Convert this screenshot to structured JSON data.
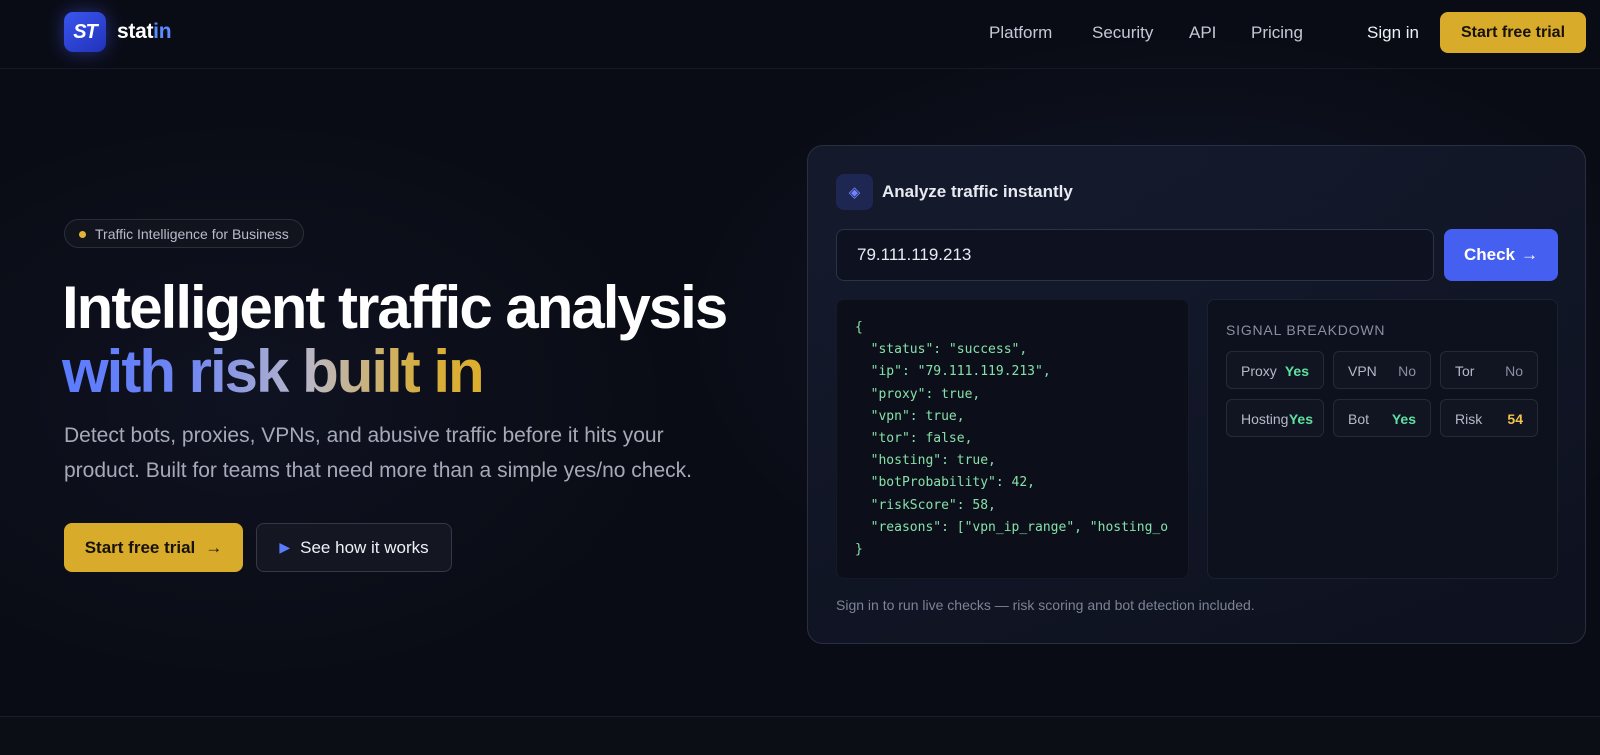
{
  "brand": {
    "logo_mark": "ST",
    "name_prefix": "stat",
    "name_suffix": "in"
  },
  "nav": {
    "links": [
      "Platform",
      "Security",
      "API",
      "Pricing"
    ],
    "sign_in": "Sign in",
    "cta": "Start free trial"
  },
  "hero": {
    "badge": "Traffic Intelligence for Business",
    "title_line1": "Intelligent traffic analysis",
    "title_line2": "with risk built in",
    "subtitle": "Detect bots, proxies, VPNs, and abusive traffic before it hits your product. Built for teams that need more than a simple yes/no check.",
    "primary_button": "Start free trial",
    "secondary_button": "See how it works"
  },
  "panel": {
    "title": "Analyze traffic instantly",
    "ip_value": "79.111.119.213",
    "check_button": "Check",
    "code_lines": [
      "{",
      "  \"status\": \"success\",",
      "  \"ip\": \"79.111.119.213\",",
      "  \"proxy\": true,",
      "  \"vpn\": true,",
      "  \"tor\": false,",
      "  \"hosting\": true,",
      "  \"botProbability\": 42,",
      "  \"riskScore\": 58,",
      "  \"reasons\": [\"vpn_ip_range\", \"hosting_o",
      "}"
    ],
    "signal_heading": "SIGNAL BREAKDOWN",
    "signals": [
      {
        "label": "Proxy",
        "value": "Yes"
      },
      {
        "label": "VPN",
        "value": "No"
      },
      {
        "label": "Tor",
        "value": "No"
      },
      {
        "label": "Hosting",
        "value": "Yes"
      },
      {
        "label": "Bot",
        "value": "Yes"
      },
      {
        "label": "Risk",
        "value": "54"
      }
    ],
    "footnote": "Sign in to run live checks — risk scoring and bot detection included."
  },
  "icons": {
    "arrow": "→",
    "play": "▶",
    "diamond": "◈"
  },
  "colors": {
    "accent_gold": "#d9ab2b",
    "accent_blue": "#4560f0",
    "positive": "#5fe0a0",
    "warning": "#f2c34a"
  }
}
